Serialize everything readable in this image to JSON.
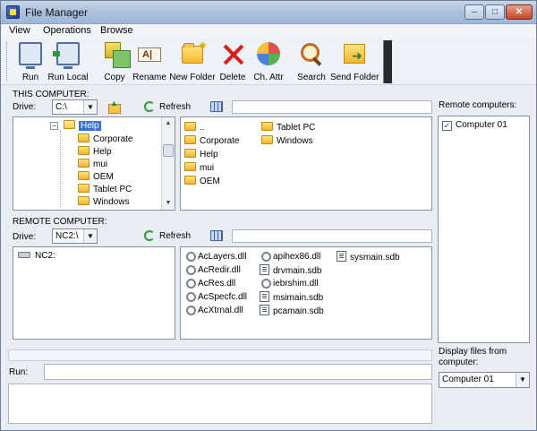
{
  "window": {
    "title": "File Manager",
    "min_glyph": "–",
    "max_glyph": "□",
    "close_glyph": "✕"
  },
  "menu": {
    "items": [
      "View",
      "Operations",
      "Browse"
    ]
  },
  "toolbar": {
    "buttons": [
      "Run",
      "Run Local",
      "Copy",
      "Rename",
      "New Folder",
      "Delete",
      "Ch. Attr",
      "Search",
      "Send Folder"
    ]
  },
  "local": {
    "section_label": "THIS COMPUTER:",
    "drive_label": "Drive:",
    "drive_value": "C:\\",
    "refresh_label": "Refresh",
    "tree": {
      "selected": "Help",
      "children": [
        "Corporate",
        "Help",
        "mui",
        "OEM",
        "Tablet PC",
        "Windows"
      ]
    },
    "files_col1": [
      "..",
      "Corporate",
      "Help",
      "mui",
      "OEM"
    ],
    "files_col2": [
      "Tablet PC",
      "Windows"
    ]
  },
  "remote": {
    "section_label": "REMOTE COMPUTER:",
    "drive_label": "Drive:",
    "drive_value": "NC2:\\",
    "refresh_label": "Refresh",
    "tree_root": "NC2:",
    "files_col1": [
      "AcLayers.dll",
      "AcRedir.dll",
      "AcRes.dll",
      "AcSpecfc.dll",
      "AcXtrnal.dll"
    ],
    "files_col2": [
      "apihex86.dll",
      "drvmain.sdb",
      "iebrshim.dll",
      "msimain.sdb",
      "pcamain.sdb"
    ],
    "files_col3": [
      "sysmain.sdb"
    ]
  },
  "sidebar": {
    "remote_computers_label": "Remote computers:",
    "computers": [
      {
        "name": "Computer 01",
        "checked": true
      }
    ],
    "display_files_label": "Display files from computer:",
    "display_files_value": "Computer 01"
  },
  "run": {
    "label": "Run:"
  },
  "colors": {
    "selection": "#3874d8",
    "window_bg": "#e9ecf1",
    "title_gradient": "#a9bfdc"
  }
}
